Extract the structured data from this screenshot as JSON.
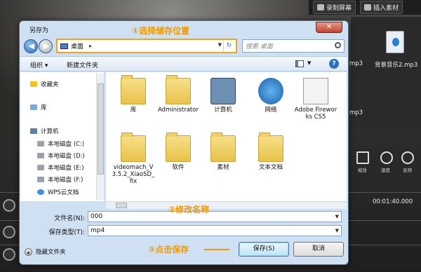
{
  "background": {
    "toolbar": {
      "record_label": "录制屏幕",
      "insert_label": "插入素材"
    },
    "media": [
      {
        "label": "mp3"
      },
      {
        "label": "背景音乐2.mp3"
      },
      {
        "label": "mp3"
      },
      {
        "label": "mp3"
      }
    ],
    "player": {
      "crop_label": "缩放",
      "speed_label": "速度",
      "volume_label": "音频"
    },
    "timeline_time": "00:01:40.000"
  },
  "dialog": {
    "title": "另存为",
    "close_symbol": "✕",
    "address": {
      "location": "桌面",
      "arrow": "▸"
    },
    "search_placeholder": "搜索 桌面",
    "annotations": {
      "step1": "①选择储存位置",
      "step2": "②修改名称",
      "step3": "③点击保存"
    },
    "toolbar": {
      "organize": "组织 ▾",
      "new_folder": "新建文件夹"
    },
    "nav_items": [
      {
        "label": "收藏夹",
        "icon": "star-icon"
      },
      {
        "label": "库",
        "icon": "library-icon"
      },
      {
        "label": "计算机",
        "icon": "computer-icon"
      },
      {
        "label": "本地磁盘 (C:)",
        "icon": "drive-icon"
      },
      {
        "label": "本地磁盘 (D:)",
        "icon": "drive-icon"
      },
      {
        "label": "本地磁盘 (E:)",
        "icon": "drive-icon"
      },
      {
        "label": "本地磁盘 (F:)",
        "icon": "drive-icon"
      },
      {
        "label": "WPS云文档",
        "icon": "cloud-icon"
      }
    ],
    "files": [
      {
        "label": "库",
        "icon": "library-folder-icon"
      },
      {
        "label": "Administrator",
        "icon": "user-folder-icon"
      },
      {
        "label": "计算机",
        "icon": "computer-icon"
      },
      {
        "label": "网络",
        "icon": "network-icon"
      },
      {
        "label": "Adobe Fireworks CS5",
        "icon": "document-icon"
      },
      {
        "label": "videomach_V3.5.2_XiaoSD_fix",
        "icon": "folder-icon"
      },
      {
        "label": "软件",
        "icon": "folder-icon"
      },
      {
        "label": "素材",
        "icon": "folder-icon"
      },
      {
        "label": "文本文档",
        "icon": "folder-icon"
      }
    ],
    "filename_label": "文件名(N):",
    "filename_value": "000",
    "filetype_label": "保存类型(T):",
    "filetype_value": "mp4",
    "hide_folders": "隐藏文件夹",
    "save_button": "保存(S)",
    "cancel_button": "取消",
    "accent": "#f39a00"
  }
}
